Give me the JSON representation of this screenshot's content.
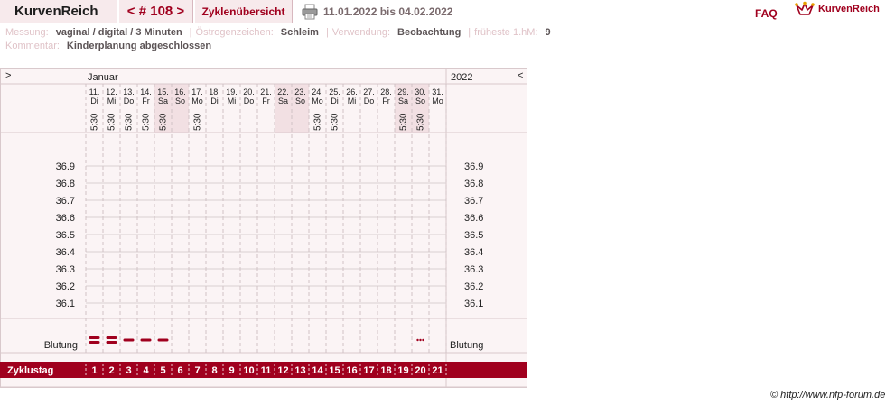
{
  "header": {
    "brand": "KurvenReich",
    "cycle_nav": "< # 108 >",
    "overview_label": "Zyklenübersicht",
    "print_icon": "printer-icon",
    "period": "11.01.2022 bis 04.02.2022",
    "faq": "FAQ",
    "logo_text": "KurvenReich",
    "logo_icon": "crown-icon"
  },
  "info": {
    "messung_label": "Messung:",
    "messung_value": "vaginal / digital / 3 Minuten",
    "oestrogen_label": "Östrogenzeichen:",
    "oestrogen_value": "Schleim",
    "verwendung_label": "Verwendung:",
    "verwendung_value": "Beobachtung",
    "hm_label": "früheste 1.hM:",
    "hm_value": "9",
    "kommentar_label": "Kommentar:",
    "kommentar_value": "Kinderplanung abgeschlossen",
    "separator": "|"
  },
  "chart_data": {
    "type": "line",
    "month": "Januar",
    "year": "2022",
    "nav_prev": ">",
    "nav_next": "<",
    "days": [
      {
        "date": "11.",
        "weekday": "Di",
        "time": "5:30",
        "cycle_day": "1",
        "weekend": false
      },
      {
        "date": "12.",
        "weekday": "Mi",
        "time": "5:30",
        "cycle_day": "2",
        "weekend": false
      },
      {
        "date": "13.",
        "weekday": "Do",
        "time": "5:30",
        "cycle_day": "3",
        "weekend": false
      },
      {
        "date": "14.",
        "weekday": "Fr",
        "time": "5:30",
        "cycle_day": "4",
        "weekend": false
      },
      {
        "date": "15.",
        "weekday": "Sa",
        "time": "5:30",
        "cycle_day": "5",
        "weekend": true
      },
      {
        "date": "16.",
        "weekday": "So",
        "time": "",
        "cycle_day": "6",
        "weekend": true
      },
      {
        "date": "17.",
        "weekday": "Mo",
        "time": "5:30",
        "cycle_day": "7",
        "weekend": false
      },
      {
        "date": "18.",
        "weekday": "Di",
        "time": "",
        "cycle_day": "8",
        "weekend": false
      },
      {
        "date": "19.",
        "weekday": "Mi",
        "time": "",
        "cycle_day": "9",
        "weekend": false
      },
      {
        "date": "20.",
        "weekday": "Do",
        "time": "",
        "cycle_day": "10",
        "weekend": false
      },
      {
        "date": "21.",
        "weekday": "Fr",
        "time": "",
        "cycle_day": "11",
        "weekend": false
      },
      {
        "date": "22.",
        "weekday": "Sa",
        "time": "",
        "cycle_day": "12",
        "weekend": true
      },
      {
        "date": "23.",
        "weekday": "So",
        "time": "",
        "cycle_day": "13",
        "weekend": true
      },
      {
        "date": "24.",
        "weekday": "Mo",
        "time": "5:30",
        "cycle_day": "14",
        "weekend": false
      },
      {
        "date": "25.",
        "weekday": "Di",
        "time": "5:30",
        "cycle_day": "15",
        "weekend": false
      },
      {
        "date": "26.",
        "weekday": "Mi",
        "time": "",
        "cycle_day": "16",
        "weekend": false
      },
      {
        "date": "27.",
        "weekday": "Do",
        "time": "",
        "cycle_day": "17",
        "weekend": false
      },
      {
        "date": "28.",
        "weekday": "Fr",
        "time": "",
        "cycle_day": "18",
        "weekend": false
      },
      {
        "date": "29.",
        "weekday": "Sa",
        "time": "5:30",
        "cycle_day": "19",
        "weekend": true
      },
      {
        "date": "30.",
        "weekday": "So",
        "time": "5:30",
        "cycle_day": "20",
        "weekend": true
      },
      {
        "date": "31.",
        "weekday": "Mo",
        "time": "",
        "cycle_day": "21",
        "weekend": false
      }
    ],
    "y_ticks": [
      "36.9",
      "36.8",
      "36.7",
      "36.6",
      "36.5",
      "36.4",
      "36.3",
      "36.2",
      "36.1"
    ],
    "ylim": [
      36.1,
      36.9
    ],
    "temperatures": [],
    "bleeding_label": "Blutung",
    "bleeding": [
      "heavy",
      "heavy",
      "medium",
      "medium",
      "medium",
      "",
      "",
      "",
      "",
      "",
      "",
      "",
      "",
      "",
      "",
      "",
      "",
      "",
      "",
      "spotting",
      ""
    ],
    "cycle_day_label": "Zyklustag",
    "colors": {
      "accent": "#a0001e",
      "panel_bg": "#fbf4f5",
      "weekend_bg": "#f2e0e3",
      "grid": "#d9cfd1"
    }
  },
  "footer": {
    "copyright": "© http://www.nfp-forum.de"
  }
}
